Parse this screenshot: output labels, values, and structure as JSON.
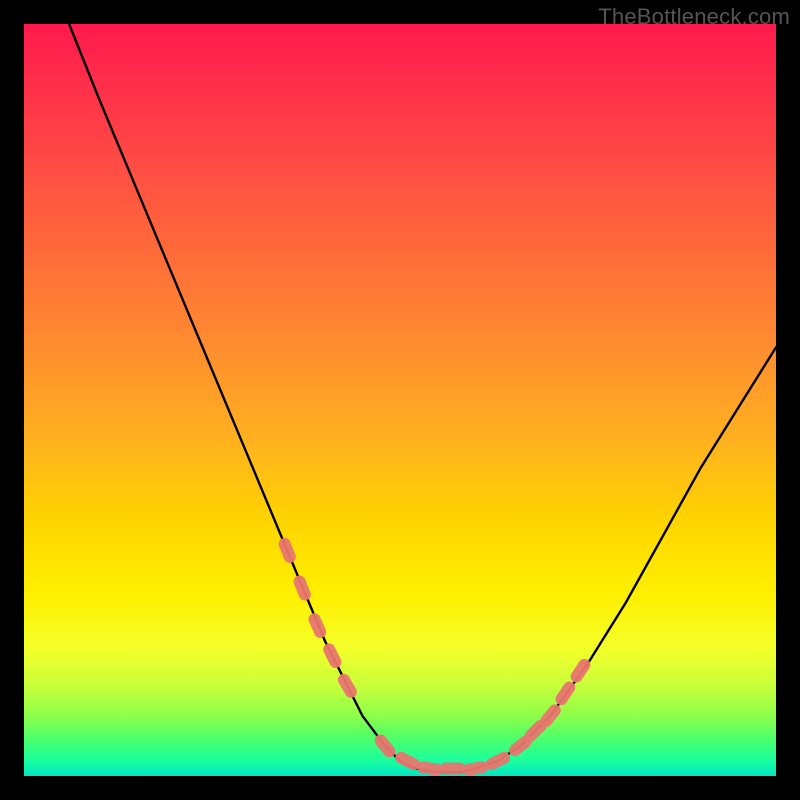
{
  "watermark": "TheBottleneck.com",
  "colors": {
    "frame": "#000000",
    "gradient_top": "#ff1a4d",
    "gradient_mid": "#fff000",
    "gradient_bottom": "#00e6c4",
    "curve": "#000000",
    "marker": "#e8766e"
  },
  "chart_data": {
    "type": "line",
    "title": "",
    "xlabel": "",
    "ylabel": "",
    "xlim": [
      0,
      100
    ],
    "ylim": [
      0,
      100
    ],
    "series": [
      {
        "name": "bottleneck-curve",
        "x": [
          6,
          10,
          15,
          20,
          25,
          30,
          35,
          40,
          45,
          48,
          50,
          52,
          55,
          58,
          60,
          63,
          66,
          70,
          75,
          80,
          85,
          90,
          95,
          100
        ],
        "values": [
          100,
          90,
          78,
          66,
          54,
          42,
          30,
          18,
          8,
          4,
          2,
          1,
          0.5,
          0.5,
          1,
          2,
          4,
          8,
          15,
          23,
          32,
          41,
          49,
          57
        ]
      }
    ],
    "markers": {
      "name": "highlighted-points",
      "x": [
        35,
        37,
        39,
        41,
        43,
        48,
        51,
        54,
        57,
        60,
        63,
        66,
        68,
        70,
        72,
        74
      ],
      "values": [
        30,
        25,
        20,
        16,
        12,
        4,
        2,
        1,
        1,
        1,
        2,
        4,
        6,
        8,
        11,
        14
      ]
    }
  }
}
